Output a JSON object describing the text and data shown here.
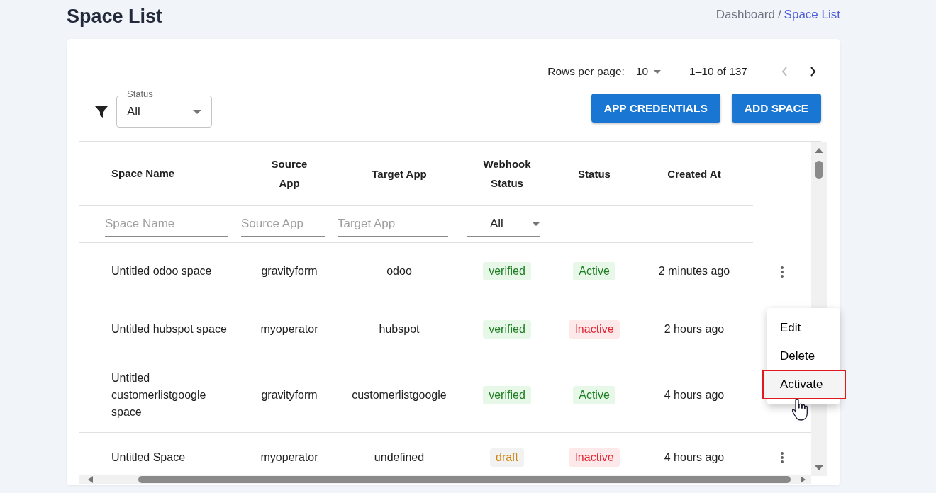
{
  "page": {
    "title": "Space List"
  },
  "breadcrumb": {
    "separator": "/",
    "items": [
      {
        "label": "Dashboard",
        "selected": false
      },
      {
        "label": "Space List",
        "selected": true
      }
    ]
  },
  "pagination": {
    "rows_per_page_label": "Rows per page:",
    "rows_per_page": "10",
    "range": "1–10 of 137",
    "prev_disabled": true,
    "next_disabled": false
  },
  "status_filter": {
    "label": "Status",
    "value": "All"
  },
  "buttons": [
    "APP CREDENTIALS",
    "ADD SPACE"
  ],
  "columns": [
    "Space Name",
    "Source App",
    "Target App",
    "Webhook Status",
    "Status",
    "Created At"
  ],
  "column_filters": [
    {
      "kind": "text",
      "placeholder": "Space Name"
    },
    {
      "kind": "text",
      "placeholder": "Source App"
    },
    {
      "kind": "text",
      "placeholder": "Target App"
    },
    {
      "kind": "select",
      "value": "All"
    }
  ],
  "rows": [
    {
      "name": "Untitled odoo space",
      "source": "gravityform",
      "target": "odoo",
      "webhook": {
        "text": "verified",
        "kind": "success"
      },
      "status": {
        "text": "Active",
        "kind": "success"
      },
      "created": "2 minutes ago"
    },
    {
      "name": "Untitled hubspot space",
      "source": "myoperator",
      "target": "hubspot",
      "webhook": {
        "text": "verified",
        "kind": "success"
      },
      "status": {
        "text": "Inactive",
        "kind": "danger"
      },
      "created": "2 hours ago"
    },
    {
      "name": "Untitled customerlistgoogle space",
      "source": "gravityform",
      "target": "customerlistgoogle",
      "webhook": {
        "text": "verified",
        "kind": "success"
      },
      "status": {
        "text": "Active",
        "kind": "success"
      },
      "created": "4 hours ago"
    },
    {
      "name": "Untitled Space",
      "source": "myoperator",
      "target": "undefined",
      "webhook": {
        "text": "draft",
        "kind": "warning"
      },
      "status": {
        "text": "Inactive",
        "kind": "danger"
      },
      "created": "4 hours ago"
    }
  ],
  "row_menu": {
    "items": [
      {
        "label": "Edit",
        "selected": false
      },
      {
        "label": "Delete",
        "selected": false
      },
      {
        "label": "Activate",
        "selected": true
      }
    ]
  }
}
